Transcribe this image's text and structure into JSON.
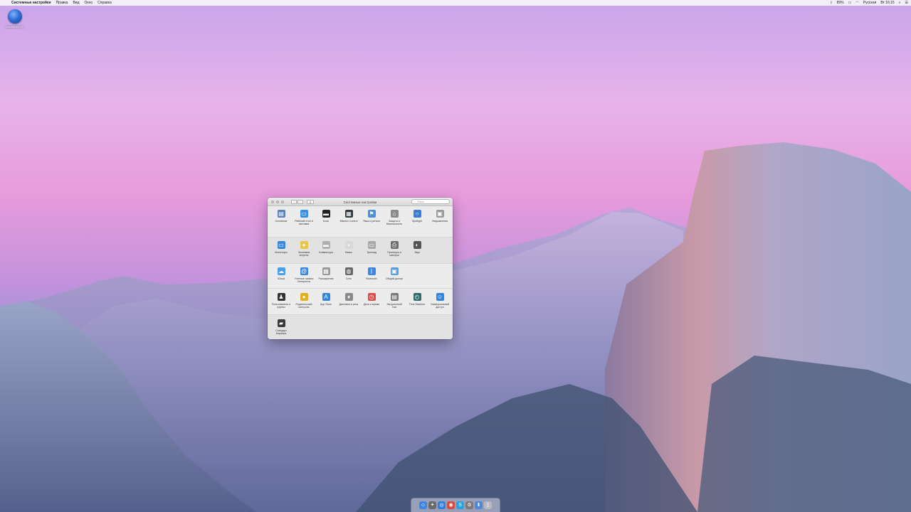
{
  "menubar": {
    "app_name": "Системные настройки",
    "items": [
      "Правка",
      "Вид",
      "Окно",
      "Справка"
    ],
    "status": {
      "battery": "89%",
      "input": "Русская",
      "clock": "Вт 16:15"
    }
  },
  "desktop": {
    "disk_label": "Macintosh HD"
  },
  "window": {
    "title": "Системные настройки",
    "search_placeholder": "Поиск",
    "nav_back": "‹",
    "nav_forward": "›",
    "grid_label": "⠿",
    "sections": [
      [
        {
          "label": "Основные",
          "icon": "general-icon",
          "color": "#5b7fb8",
          "glyph": "▤"
        },
        {
          "label": "Рабочий стол и заставка",
          "icon": "desktop-icon",
          "color": "#3b8fe0",
          "glyph": "▭"
        },
        {
          "label": "Dock",
          "icon": "dock-icon",
          "color": "#222222",
          "glyph": "▬"
        },
        {
          "label": "Mission Control",
          "icon": "mission-control-icon",
          "color": "#2f3a3f",
          "glyph": "▦"
        },
        {
          "label": "Язык и регион",
          "icon": "language-icon",
          "color": "#4a90d9",
          "glyph": "⚑"
        },
        {
          "label": "Защита и безопасность",
          "icon": "security-icon",
          "color": "#8a8a8a",
          "glyph": "⌂"
        },
        {
          "label": "Spotlight",
          "icon": "spotlight-icon",
          "color": "#3a7bd5",
          "glyph": "○"
        },
        {
          "label": "Уведомления",
          "icon": "notifications-icon",
          "color": "#9a9a9a",
          "glyph": "▣"
        }
      ],
      [
        {
          "label": "Мониторы",
          "icon": "displays-icon",
          "color": "#3b86d8",
          "glyph": "▭"
        },
        {
          "label": "Экономия энергии",
          "icon": "energy-icon",
          "color": "#e8c64a",
          "glyph": "●"
        },
        {
          "label": "Клавиатура",
          "icon": "keyboard-icon",
          "color": "#b0b0b0",
          "glyph": "▬"
        },
        {
          "label": "Мышь",
          "icon": "mouse-icon",
          "color": "#d8d8d8",
          "glyph": "◗"
        },
        {
          "label": "Трекпад",
          "icon": "trackpad-icon",
          "color": "#a8a8a8",
          "glyph": "▭"
        },
        {
          "label": "Принтеры и сканеры",
          "icon": "printer-icon",
          "color": "#6e6e6e",
          "glyph": "⎙"
        },
        {
          "label": "Звук",
          "icon": "sound-icon",
          "color": "#555555",
          "glyph": "◐"
        }
      ],
      [
        {
          "label": "iCloud",
          "icon": "icloud-icon",
          "color": "#4aa0e8",
          "glyph": "☁"
        },
        {
          "label": "Учетные записи Интернета",
          "icon": "internet-accounts-icon",
          "color": "#3a86d8",
          "glyph": "@"
        },
        {
          "label": "Расширения",
          "icon": "extensions-icon",
          "color": "#9a9a9a",
          "glyph": "▩"
        },
        {
          "label": "Сеть",
          "icon": "network-icon",
          "color": "#6a6a6a",
          "glyph": "◍"
        },
        {
          "label": "Bluetooth",
          "icon": "bluetooth-icon",
          "color": "#3a86e0",
          "glyph": "ᛒ"
        },
        {
          "label": "Общий доступ",
          "icon": "sharing-icon",
          "color": "#5aa0e0",
          "glyph": "▣"
        }
      ],
      [
        {
          "label": "Пользователи и группы",
          "icon": "users-icon",
          "color": "#333333",
          "glyph": "♟"
        },
        {
          "label": "Родительский контроль",
          "icon": "parental-controls-icon",
          "color": "#e0b020",
          "glyph": "●"
        },
        {
          "label": "App Store",
          "icon": "app-store-icon",
          "color": "#2f86e0",
          "glyph": "A"
        },
        {
          "label": "Диктовка и речь",
          "icon": "dictation-icon",
          "color": "#8a8a8a",
          "glyph": "♦"
        },
        {
          "label": "Дата и время",
          "icon": "date-time-icon",
          "color": "#e04a4a",
          "glyph": "◷"
        },
        {
          "label": "Загрузочный том",
          "icon": "startup-disk-icon",
          "color": "#7a7a7a",
          "glyph": "▤"
        },
        {
          "label": "Time Machine",
          "icon": "time-machine-icon",
          "color": "#2e6b6b",
          "glyph": "◴"
        },
        {
          "label": "Универсальный доступ",
          "icon": "accessibility-icon",
          "color": "#2f86e0",
          "glyph": "☺"
        }
      ],
      [
        {
          "label": "Стандарт Маузера",
          "icon": "mouse-standard-icon",
          "color": "#3a3a3a",
          "glyph": "▰"
        }
      ]
    ]
  },
  "dock": [
    {
      "name": "finder",
      "color": "#3a86e0",
      "glyph": "☺"
    },
    {
      "name": "launchpad",
      "color": "#6a6a6a",
      "glyph": "✦"
    },
    {
      "name": "safari",
      "color": "#2f7fe0",
      "glyph": "◎"
    },
    {
      "name": "chrome",
      "color": "#d84a3a",
      "glyph": "◉"
    },
    {
      "name": "skype",
      "color": "#2aa0e0",
      "glyph": "S"
    },
    {
      "name": "system-preferences",
      "color": "#7a7a7a",
      "glyph": "⚙"
    },
    {
      "name": "downloads",
      "color": "#4a8ad8",
      "glyph": "⬇"
    },
    {
      "name": "trash",
      "color": "#b8b8c0",
      "glyph": "▯"
    }
  ]
}
